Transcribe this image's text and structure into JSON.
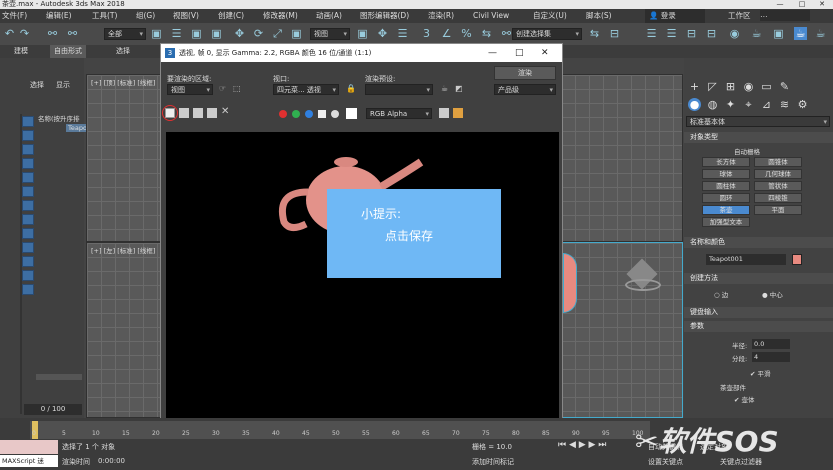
{
  "app": {
    "title": "茶壶.max - Autodesk 3ds Max 2018",
    "window_controls": {
      "minimize": "—",
      "maximize": "□",
      "close": "✕"
    }
  },
  "menu": [
    "文件(F)",
    "编辑(E)",
    "工具(T)",
    "组(G)",
    "视图(V)",
    "创建(C)",
    "修改器(M)",
    "动画(A)",
    "图形编辑器(D)",
    "渲染(R)",
    "Civil View",
    "自定义(U)",
    "脚本(S)"
  ],
  "menu_right": {
    "user": "登录",
    "workspace": "工作区",
    "dots": "⋯"
  },
  "toolbar": {
    "filter": "全部",
    "view": "视图",
    "selection_set": "创建选择集",
    "icons": {
      "undo": "↶",
      "redo": "↷",
      "link": "⚯",
      "select": "▣",
      "move": "✥",
      "rotate": "⟳",
      "scale": "⤢",
      "snap": "3",
      "angle_snap": "∠",
      "percent": "%",
      "mirror": "⇆",
      "align": "⊟",
      "layers": "☰",
      "material": "◉",
      "render": "☕"
    }
  },
  "ribbon": {
    "tabs": [
      "建模",
      "自由形式",
      "选择"
    ]
  },
  "left_panel": {
    "tabs": [
      "选择",
      "显示"
    ],
    "header": "名称(按升序排",
    "item": "Teapot",
    "frames": "0 / 100"
  },
  "viewports": {
    "top_left": "[+] [顶] [标准] [线框]",
    "bottom_left": "[+] [左] [标准] [线框]"
  },
  "render_window": {
    "title": "透视, 帧 0, 显示 Gamma: 2.2, RGBA 颜色 16 位/通道 (1:1)",
    "area_label": "要渲染的区域:",
    "area_value": "视图",
    "viewport_label": "视口:",
    "viewport_value": "四元菜... 透视",
    "preset_label": "渲染预设:",
    "preset_value": "",
    "render_button": "渲染",
    "product_value": "产品级",
    "channel_value": "RGB Alpha",
    "colors": {
      "red": "#e03030",
      "green": "#30b050",
      "blue": "#3080e0",
      "gray": "#888888",
      "white": "#ffffff"
    }
  },
  "tip": {
    "line1": "小提示:",
    "line2": "点击保存"
  },
  "right_panel": {
    "category": "标准基本体",
    "object_type_title": "对象类型",
    "autogrid": "自动栅格",
    "buttons": [
      "长方体",
      "圆锥体",
      "球体",
      "几何球体",
      "圆柱体",
      "管状体",
      "圆环",
      "四棱锥",
      "茶壶",
      "平面",
      "加强型文本"
    ],
    "name_color_title": "名称和颜色",
    "object_name": "Teapot001",
    "object_color": "#e88a80",
    "creation_method_title": "创建方法",
    "creation_options": [
      "边",
      "中心"
    ],
    "keyboard_title": "键盘输入",
    "params_title": "参数",
    "radius_label": "半径:",
    "radius_value": "0.0",
    "segments_label": "分段:",
    "segments_value": "4",
    "smooth_label": "平滑",
    "parts_label": "茶壶部件",
    "body_label": "壶体"
  },
  "status": {
    "selected": "选择了 1 个 对象",
    "render_time_label": "渲染时间",
    "render_time_value": "0:00:00",
    "script": "MAXScript 迷",
    "grid_label": "栅格 = 10.0",
    "add_tag": "添加时间标记",
    "autokey": "自动关键点",
    "set_key": "设置关键点",
    "filter": "关键点过滤器",
    "selected_obj": "选定对象"
  },
  "timeline": {
    "ticks": [
      "0",
      "5",
      "10",
      "15",
      "20",
      "25",
      "30",
      "35",
      "40",
      "45",
      "50",
      "55",
      "60",
      "65",
      "70",
      "75",
      "80",
      "85",
      "90",
      "95",
      "100"
    ]
  },
  "watermark": "软件SOS"
}
